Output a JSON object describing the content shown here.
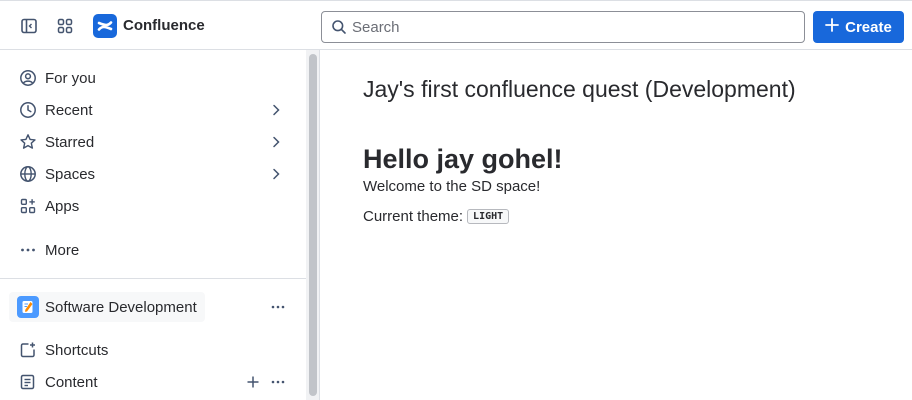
{
  "topbar": {
    "brand": "Confluence",
    "search_placeholder": "Search",
    "create_label": "Create",
    "accent": "#1868db"
  },
  "sidebar": {
    "items": [
      {
        "label": "For you",
        "icon": "person-circle-icon"
      },
      {
        "label": "Recent",
        "icon": "clock-icon",
        "has_chevron": true
      },
      {
        "label": "Starred",
        "icon": "star-icon",
        "has_chevron": true
      },
      {
        "label": "Spaces",
        "icon": "globe-icon",
        "has_chevron": true
      },
      {
        "label": "Apps",
        "icon": "apps-icon"
      },
      {
        "label": "More",
        "icon": "more-horizontal-icon"
      }
    ],
    "space": {
      "name": "Software Development"
    },
    "space_items": [
      {
        "label": "Shortcuts",
        "icon": "shortcut-icon"
      },
      {
        "label": "Content",
        "icon": "content-icon"
      }
    ]
  },
  "main": {
    "page_title": "Jay's first confluence quest (Development)",
    "heading": "Hello jay gohel!",
    "welcome": "Welcome to the SD space!",
    "theme_label": "Current theme:",
    "theme_value": "LIGHT"
  }
}
